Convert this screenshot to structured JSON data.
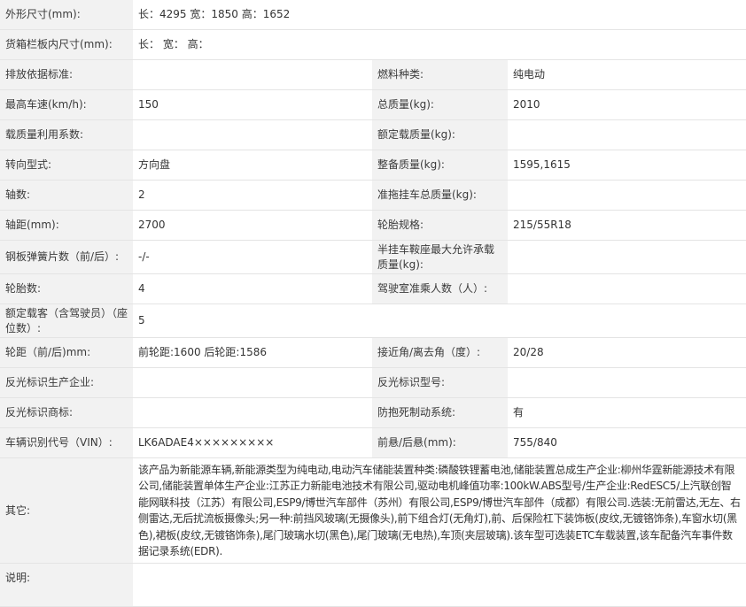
{
  "rows": {
    "r0": {
      "l1": "外形尺寸(mm):",
      "v1": "长：4295 宽：1850 高：1652"
    },
    "r1": {
      "l1": "货箱栏板内尺寸(mm):",
      "v1": "长：  宽：  高："
    },
    "r2": {
      "l1": "排放依据标准:",
      "v1": "",
      "l2": "燃料种类:",
      "v2": "纯电动"
    },
    "r3": {
      "l1": "最高车速(km/h):",
      "v1": "150",
      "l2": "总质量(kg):",
      "v2": "2010"
    },
    "r4": {
      "l1": "载质量利用系数:",
      "v1": "",
      "l2": "额定载质量(kg):",
      "v2": ""
    },
    "r5": {
      "l1": "转向型式:",
      "v1": "方向盘",
      "l2": "整备质量(kg):",
      "v2": "1595,1615"
    },
    "r6": {
      "l1": "轴数:",
      "v1": "2",
      "l2": "准拖挂车总质量(kg):",
      "v2": ""
    },
    "r7": {
      "l1": "轴距(mm):",
      "v1": "2700",
      "l2": "轮胎规格:",
      "v2": "215/55R18"
    },
    "r8": {
      "l1": "钢板弹簧片数（前/后）:",
      "v1": "-/-",
      "l2": "半挂车鞍座最大允许承载质量(kg):",
      "v2": ""
    },
    "r9": {
      "l1": "轮胎数:",
      "v1": "4",
      "l2": "驾驶室准乘人数（人）:",
      "v2": ""
    },
    "r10": {
      "l1": "额定载客（含驾驶员）（座位数）:",
      "v1": "5"
    },
    "r11": {
      "l1": "轮距（前/后)mm:",
      "v1": "前轮距:1600 后轮距:1586",
      "l2": "接近角/离去角（度）:",
      "v2": "20/28"
    },
    "r12": {
      "l1": "反光标识生产企业:",
      "v1": "",
      "l2": "反光标识型号:",
      "v2": ""
    },
    "r13": {
      "l1": "反光标识商标:",
      "v1": "",
      "l2": "防抱死制动系统:",
      "v2": "有"
    },
    "r14": {
      "l1": "车辆识别代号（VIN）:",
      "v1": "LK6ADAE4×××××××××",
      "l2": "前悬/后悬(mm):",
      "v2": "755/840"
    },
    "r15": {
      "l1": "其它:",
      "v1": "该产品为新能源车辆,新能源类型为纯电动,电动汽车储能装置种类:磷酸铁锂蓄电池,储能装置总成生产企业:柳州华霆新能源技术有限公司,储能装置单体生产企业:江苏正力新能电池技术有限公司,驱动电机峰值功率:100kW.ABS型号/生产企业:RedESC5/上汽联创智能网联科技（江苏）有限公司,ESP9/博世汽车部件（苏州）有限公司,ESP9/博世汽车部件（成都）有限公司.选装:无前雷达,无左、右侧雷达,无后扰流板摄像头;另一种:前挡风玻璃(无摄像头),前下组合灯(无角灯),前、后保险杠下装饰板(皮纹,无镀铬饰条),车窗水切(黑色),裙板(皮纹,无镀铬饰条),尾门玻璃水切(黑色),尾门玻璃(无电热),车顶(夹层玻璃).该车型可选装ETC车载装置,该车配备汽车事件数据记录系统(EDR)."
    },
    "r16": {
      "l1": "说明:",
      "v1": ""
    }
  }
}
